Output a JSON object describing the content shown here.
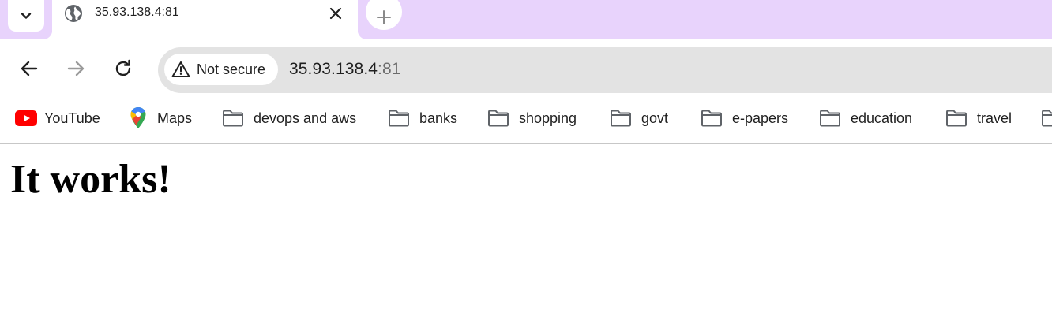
{
  "tab": {
    "title": "35.93.138.4:81"
  },
  "address_bar": {
    "security_label": "Not secure",
    "host": "35.93.138.4",
    "port": ":81"
  },
  "bookmarks": [
    {
      "label": "YouTube",
      "icon": "youtube-icon"
    },
    {
      "label": "Maps",
      "icon": "maps-icon"
    },
    {
      "label": "devops and aws",
      "icon": "folder-icon"
    },
    {
      "label": "banks",
      "icon": "folder-icon"
    },
    {
      "label": "shopping",
      "icon": "folder-icon"
    },
    {
      "label": "govt",
      "icon": "folder-icon"
    },
    {
      "label": "e-papers",
      "icon": "folder-icon"
    },
    {
      "label": "education",
      "icon": "folder-icon"
    },
    {
      "label": "travel",
      "icon": "folder-icon"
    }
  ],
  "page": {
    "heading": "It works!"
  },
  "colors": {
    "tabstrip_bg": "#e8d3fc",
    "omnibox_bg": "#e3e3e3",
    "youtube_red": "#ff0000"
  }
}
